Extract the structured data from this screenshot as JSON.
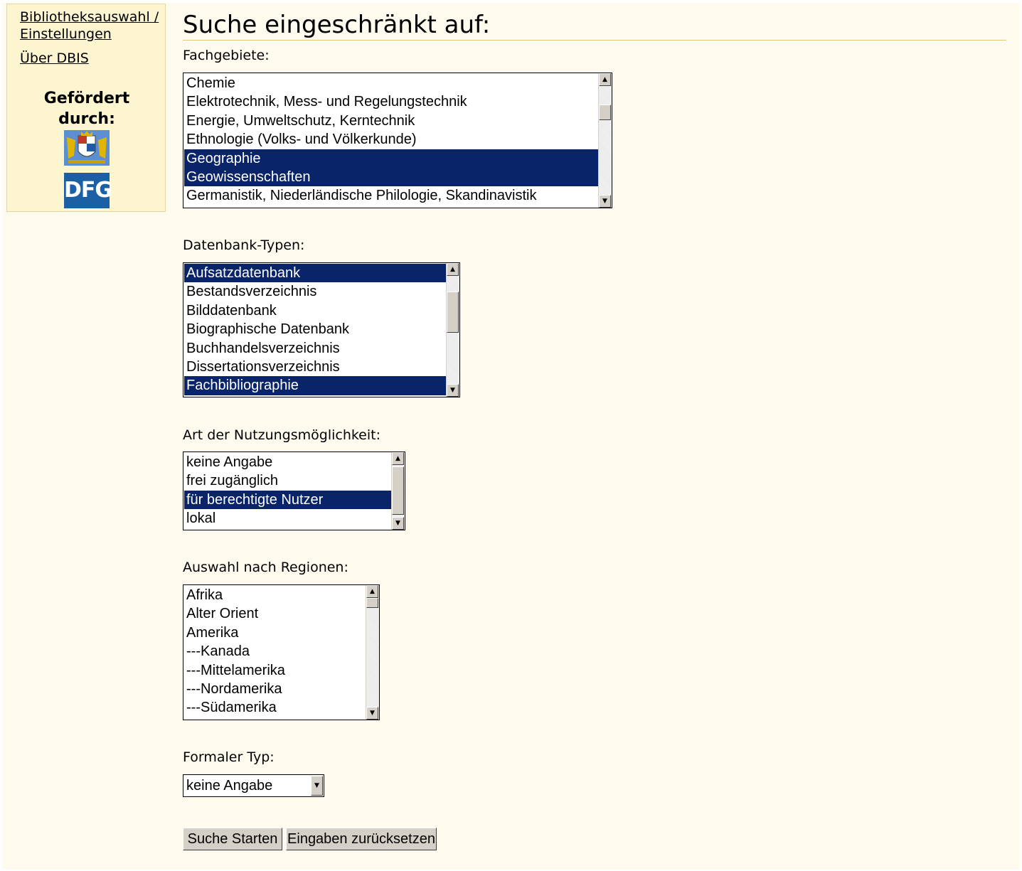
{
  "sidebar": {
    "link_library": "Bibliotheksauswahl / Einstellungen",
    "link_about": "Über DBIS",
    "sponsored_by": "Gefördert durch:",
    "dfg_logo_text": "DFG"
  },
  "main": {
    "title": "Suche eingeschränkt auf:",
    "fachgebiete": {
      "label": "Fachgebiete:",
      "options": [
        {
          "text": "Chemie",
          "selected": false
        },
        {
          "text": "Elektrotechnik, Mess- und Regelungstechnik",
          "selected": false
        },
        {
          "text": "Energie, Umweltschutz, Kerntechnik",
          "selected": false
        },
        {
          "text": "Ethnologie (Volks- und Völkerkunde)",
          "selected": false
        },
        {
          "text": "Geographie",
          "selected": true
        },
        {
          "text": "Geowissenschaften",
          "selected": true
        },
        {
          "text": "Germanistik, Niederländische Philologie, Skandinavistik",
          "selected": false
        }
      ]
    },
    "datenbank_typen": {
      "label": "Datenbank-Typen:",
      "options": [
        {
          "text": "Aufsatzdatenbank",
          "selected": true
        },
        {
          "text": "Bestandsverzeichnis",
          "selected": false
        },
        {
          "text": "Bilddatenbank",
          "selected": false
        },
        {
          "text": "Biographische Datenbank",
          "selected": false
        },
        {
          "text": "Buchhandelsverzeichnis",
          "selected": false
        },
        {
          "text": "Dissertationsverzeichnis",
          "selected": false
        },
        {
          "text": "Fachbibliographie",
          "selected": true
        }
      ]
    },
    "nutzung": {
      "label": "Art der Nutzungsmöglichkeit:",
      "options": [
        {
          "text": "keine Angabe",
          "selected": false
        },
        {
          "text": "frei zugänglich",
          "selected": false
        },
        {
          "text": "für berechtigte Nutzer",
          "selected": true
        },
        {
          "text": "lokal",
          "selected": false
        }
      ]
    },
    "regionen": {
      "label": "Auswahl nach Regionen:",
      "options": [
        {
          "text": "Afrika",
          "selected": false
        },
        {
          "text": "Alter Orient",
          "selected": false
        },
        {
          "text": "Amerika",
          "selected": false
        },
        {
          "text": "---Kanada",
          "selected": false
        },
        {
          "text": "---Mittelamerika",
          "selected": false
        },
        {
          "text": "---Nordamerika",
          "selected": false
        },
        {
          "text": "---Südamerika",
          "selected": false
        }
      ]
    },
    "formaler_typ": {
      "label": "Formaler Typ:",
      "selected_value": "keine Angabe"
    },
    "buttons": {
      "search": "Suche Starten",
      "reset": "Eingaben zurücksetzen"
    }
  }
}
